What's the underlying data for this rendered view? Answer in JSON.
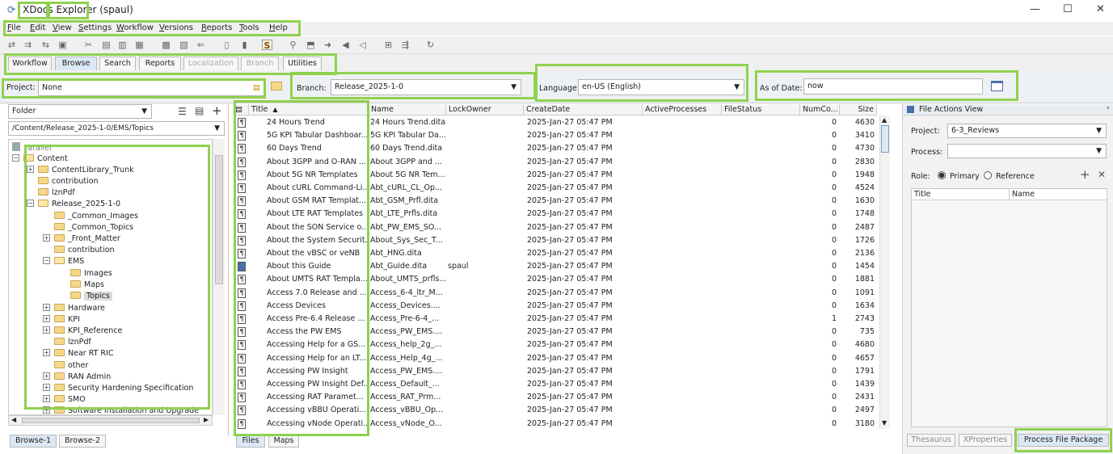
{
  "window": {
    "title": "XDocs Explorer (spaul)",
    "minimize": "—",
    "maximize": "☐",
    "close": "✕"
  },
  "menu": [
    "File",
    "Edit",
    "View",
    "Settings",
    "Workflow",
    "Versions",
    "Reports",
    "Tools",
    "Help"
  ],
  "tabs": [
    {
      "label": "Workflow",
      "state": "normal"
    },
    {
      "label": "Browse",
      "state": "active"
    },
    {
      "label": "Search",
      "state": "normal"
    },
    {
      "label": "Reports",
      "state": "normal"
    },
    {
      "label": "Localization",
      "state": "disabled"
    },
    {
      "label": "Branch",
      "state": "disabled"
    },
    {
      "label": "Utilities",
      "state": "normal"
    }
  ],
  "filters": {
    "project_label": "Project:",
    "project_value": "None",
    "branch_label": "Branch:",
    "branch_value": "Release_2025-1-0",
    "language_label": "Language:",
    "language_value": "en-US (English)",
    "asof_label": "As of Date:",
    "asof_value": "now"
  },
  "left": {
    "view_select": "Folder",
    "path": "/Content/Release_2025-1-0/EMS/Topics",
    "tree": [
      {
        "label": "Parallel",
        "exp": "",
        "icon": "none"
      },
      {
        "label": "Content",
        "exp": "−",
        "icon": "open"
      },
      {
        "label": "ContentLibrary_Trunk",
        "exp": "+",
        "icon": "closed"
      },
      {
        "label": "contribution",
        "exp": "",
        "icon": "closed"
      },
      {
        "label": "lznPdf",
        "exp": "",
        "icon": "closed"
      },
      {
        "label": "Release_2025-1-0",
        "exp": "−",
        "icon": "open"
      },
      {
        "label": "_Common_Images",
        "exp": "",
        "icon": "closed"
      },
      {
        "label": "_Common_Topics",
        "exp": "",
        "icon": "closed"
      },
      {
        "label": "_Front_Matter",
        "exp": "+",
        "icon": "closed"
      },
      {
        "label": "contribution",
        "exp": "",
        "icon": "closed"
      },
      {
        "label": "EMS",
        "exp": "−",
        "icon": "open"
      },
      {
        "label": "Images",
        "exp": "",
        "icon": "closed"
      },
      {
        "label": "Maps",
        "exp": "",
        "icon": "closed"
      },
      {
        "label": "Topics",
        "exp": "",
        "icon": "closed",
        "selected": true
      },
      {
        "label": "Hardware",
        "exp": "+",
        "icon": "closed"
      },
      {
        "label": "KPI",
        "exp": "+",
        "icon": "closed"
      },
      {
        "label": "KPI_Reference",
        "exp": "+",
        "icon": "closed"
      },
      {
        "label": "lznPdf",
        "exp": "",
        "icon": "closed"
      },
      {
        "label": "Near RT RIC",
        "exp": "+",
        "icon": "closed"
      },
      {
        "label": "other",
        "exp": "",
        "icon": "closed"
      },
      {
        "label": "RAN Admin",
        "exp": "+",
        "icon": "closed"
      },
      {
        "label": "Security Hardening Specification",
        "exp": "+",
        "icon": "closed"
      },
      {
        "label": "SMO",
        "exp": "+",
        "icon": "closed"
      },
      {
        "label": "Software Installation and Upgrade",
        "exp": "+",
        "icon": "closed"
      }
    ],
    "bottom_tabs": [
      "Browse-1",
      "Browse-2"
    ]
  },
  "center": {
    "columns": [
      "Title",
      "Name",
      "LockOwner",
      "CreateDate",
      "ActiveProcesses",
      "FileStatus",
      "NumCo...",
      "Size"
    ],
    "sort_indicator": "▲",
    "rows": [
      {
        "title": "24 Hours Trend",
        "name": "24 Hours Trend.dita",
        "lock": "",
        "date": "2025-Jan-27 05:47 PM",
        "num": "0",
        "size": "4630"
      },
      {
        "title": "5G KPI Tabular Dashboar...",
        "name": "5G KPI Tabular Da...",
        "lock": "",
        "date": "2025-Jan-27 05:47 PM",
        "num": "0",
        "size": "3410"
      },
      {
        "title": "60 Days Trend",
        "name": "60 Days Trend.dita",
        "lock": "",
        "date": "2025-Jan-27 05:47 PM",
        "num": "0",
        "size": "4730"
      },
      {
        "title": "About 3GPP and O-RAN ...",
        "name": "About 3GPP and ...",
        "lock": "",
        "date": "2025-Jan-27 05:47 PM",
        "num": "0",
        "size": "2830"
      },
      {
        "title": "About 5G NR Templates",
        "name": "About 5G NR Tem...",
        "lock": "",
        "date": "2025-Jan-27 05:47 PM",
        "num": "0",
        "size": "1948"
      },
      {
        "title": "About cURL Command-Li...",
        "name": "Abt_cURL_CL_Op...",
        "lock": "",
        "date": "2025-Jan-27 05:47 PM",
        "num": "0",
        "size": "4524"
      },
      {
        "title": "About GSM RAT Templat...",
        "name": "Abt_GSM_Prfl.dita",
        "lock": "",
        "date": "2025-Jan-27 05:47 PM",
        "num": "0",
        "size": "1630"
      },
      {
        "title": "About LTE RAT Templates",
        "name": "Abt_LTE_Prfls.dita",
        "lock": "",
        "date": "2025-Jan-27 05:47 PM",
        "num": "0",
        "size": "1748"
      },
      {
        "title": "About the SON Service o...",
        "name": "Abt_PW_EMS_SO...",
        "lock": "",
        "date": "2025-Jan-27 05:47 PM",
        "num": "0",
        "size": "2487"
      },
      {
        "title": "About the System Securit...",
        "name": "About_Sys_Sec_T...",
        "lock": "",
        "date": "2025-Jan-27 05:47 PM",
        "num": "0",
        "size": "1726"
      },
      {
        "title": "About the vBSC or veNB",
        "name": "Abt_HNG.dita",
        "lock": "",
        "date": "2025-Jan-27 05:47 PM",
        "num": "0",
        "size": "2136"
      },
      {
        "title": "About this Guide",
        "name": "Abt_Guide.dita",
        "lock": "spaul",
        "date": "2025-Jan-27 05:47 PM",
        "num": "0",
        "size": "1454",
        "locked": true
      },
      {
        "title": "About UMTS RAT Templa...",
        "name": "About_UMTS_prfls...",
        "lock": "",
        "date": "2025-Jan-27 05:47 PM",
        "num": "0",
        "size": "1881"
      },
      {
        "title": "Access 7.0 Release and ...",
        "name": "Access_6-4_ltr_M...",
        "lock": "",
        "date": "2025-Jan-27 05:47 PM",
        "num": "0",
        "size": "1091"
      },
      {
        "title": "Access Devices",
        "name": "Access_Devices....",
        "lock": "",
        "date": "2025-Jan-27 05:47 PM",
        "num": "0",
        "size": "1634"
      },
      {
        "title": "Access Pre-6.4 Release ...",
        "name": "Access_Pre-6-4_...",
        "lock": "",
        "date": "2025-Jan-27 05:47 PM",
        "num": "1",
        "size": "2743"
      },
      {
        "title": "Access the PW EMS",
        "name": "Access_PW_EMS....",
        "lock": "",
        "date": "2025-Jan-27 05:47 PM",
        "num": "0",
        "size": "735"
      },
      {
        "title": "Accessing Help for a GS...",
        "name": "Access_help_2g_...",
        "lock": "",
        "date": "2025-Jan-27 05:47 PM",
        "num": "0",
        "size": "4680"
      },
      {
        "title": "Accessing Help for an LT...",
        "name": "Access_Help_4g_...",
        "lock": "",
        "date": "2025-Jan-27 05:47 PM",
        "num": "0",
        "size": "4657"
      },
      {
        "title": "Accessing PW Insight",
        "name": "Access_PW_EMS....",
        "lock": "",
        "date": "2025-Jan-27 05:47 PM",
        "num": "0",
        "size": "1791"
      },
      {
        "title": "Accessing PW Insight Def...",
        "name": "Access_Default_...",
        "lock": "",
        "date": "2025-Jan-27 05:47 PM",
        "num": "0",
        "size": "1439"
      },
      {
        "title": "Accessing RAT Paramet...",
        "name": "Access_RAT_Prm...",
        "lock": "",
        "date": "2025-Jan-27 05:47 PM",
        "num": "0",
        "size": "2431"
      },
      {
        "title": "Accessing vBBU Operati...",
        "name": "Access_vBBU_Op...",
        "lock": "",
        "date": "2025-Jan-27 05:47 PM",
        "num": "0",
        "size": "2497"
      },
      {
        "title": "Accessing vNode Operati...",
        "name": "Access_vNode_O...",
        "lock": "",
        "date": "2025-Jan-27 05:47 PM",
        "num": "0",
        "size": "3180"
      }
    ],
    "bottom_tabs": [
      "Files",
      "Maps"
    ]
  },
  "right": {
    "panel_title": "File Actions View",
    "project_label": "Project:",
    "project_value": "6-3_Reviews",
    "process_label": "Process:",
    "process_value": "",
    "role_label": "Role:",
    "role_primary": "Primary",
    "role_reference": "Reference",
    "add_glyph": "+",
    "remove_glyph": "✕",
    "columns": [
      "Title",
      "Name"
    ],
    "bottom_tabs": [
      "Thesaurus",
      "XProperties",
      "Process File Package"
    ]
  },
  "colors": {
    "highlight": "#8fd14f",
    "active_tab": "#dce8f5"
  }
}
